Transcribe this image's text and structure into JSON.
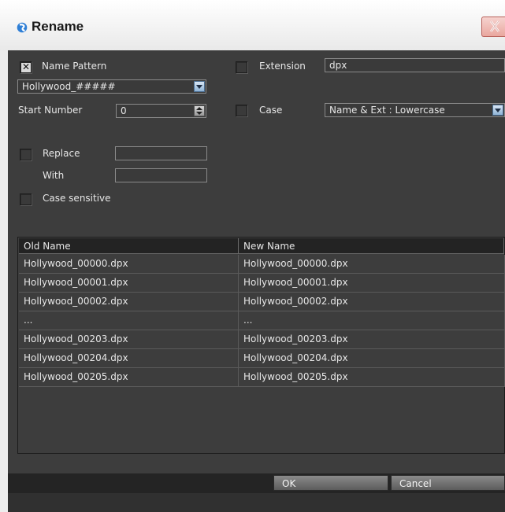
{
  "window": {
    "title": "Rename"
  },
  "options": {
    "name_pattern": {
      "label": "Name Pattern",
      "checked": true,
      "value": "Hollywood_#####"
    },
    "start_number": {
      "label": "Start Number",
      "value": "0"
    },
    "extension": {
      "label": "Extension",
      "checked": false,
      "value": "dpx"
    },
    "case": {
      "label": "Case",
      "checked": false,
      "value": "Name & Ext : Lowercase"
    },
    "replace": {
      "label": "Replace",
      "checked": false,
      "value": ""
    },
    "with": {
      "label": "With",
      "value": ""
    },
    "case_sensitive": {
      "label": "Case sensitive",
      "checked": false
    }
  },
  "table": {
    "columns": [
      "Old Name",
      "New Name"
    ],
    "rows": [
      [
        "Hollywood_00000.dpx",
        "Hollywood_00000.dpx"
      ],
      [
        "Hollywood_00001.dpx",
        "Hollywood_00001.dpx"
      ],
      [
        "Hollywood_00002.dpx",
        "Hollywood_00002.dpx"
      ],
      [
        "...",
        "..."
      ],
      [
        "Hollywood_00203.dpx",
        "Hollywood_00203.dpx"
      ],
      [
        "Hollywood_00204.dpx",
        "Hollywood_00204.dpx"
      ],
      [
        "Hollywood_00205.dpx",
        "Hollywood_00205.dpx"
      ]
    ]
  },
  "buttons": {
    "ok": "OK",
    "cancel": "Cancel"
  },
  "colors": {
    "panel": "#3d3d3d",
    "header": "#232323",
    "accent_blue": "#8fb3d6"
  },
  "icons": {
    "title": "app-logo-icon",
    "close": "close-icon"
  }
}
